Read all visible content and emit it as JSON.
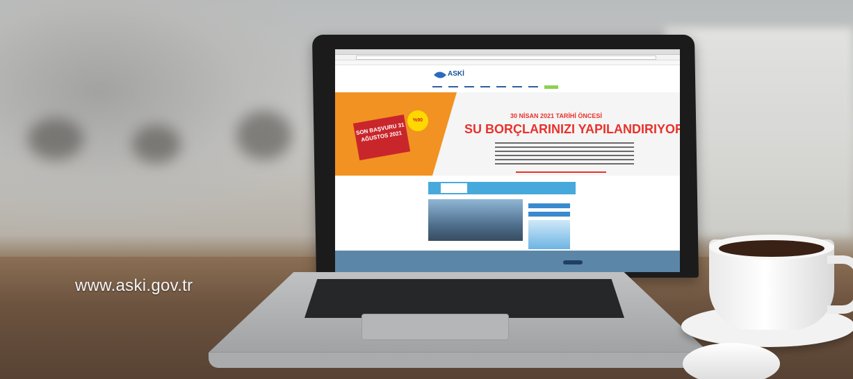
{
  "photo": {
    "overlay_url": "www.aski.gov.tr"
  },
  "laptop_screen": {
    "site_logo": "ASKİ",
    "banner": {
      "small_headline": "30 NİSAN 2021 TARİHİ ÖNCESİ",
      "main_headline": "SU BORÇLARINIZI YAPILANDIRIYORUZ",
      "sign_text": "SON BAŞVURU 31 AĞUSTOS 2021",
      "badge_text": "%90"
    }
  }
}
